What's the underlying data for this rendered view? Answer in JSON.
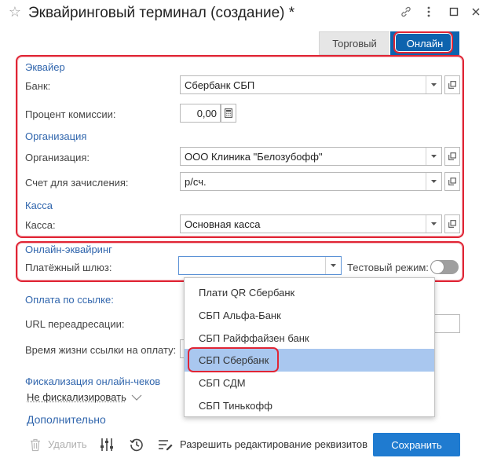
{
  "window": {
    "title": "Эквайринговый терминал (создание) *"
  },
  "tabs": [
    {
      "label": "Торговый",
      "active": false
    },
    {
      "label": "Онлайн",
      "active": true
    }
  ],
  "acquirer": {
    "heading": "Эквайер",
    "bank_label": "Банк:",
    "bank_value": "Сбербанк СБП",
    "commission_label": "Процент комиссии:",
    "commission_value": "0,00"
  },
  "organization": {
    "heading": "Организация",
    "org_label": "Организация:",
    "org_value": "ООО Клиника \"Белозубофф\"",
    "account_label": "Счет для зачисления:",
    "account_value": "р/сч."
  },
  "cash": {
    "heading": "Касса",
    "cash_label": "Касса:",
    "cash_value": "Основная касса"
  },
  "online_acquiring": {
    "heading": "Онлайн-эквайринг",
    "gateway_label": "Платёжный шлюз:",
    "gateway_value": "",
    "test_mode_label": "Тестовый режим:",
    "test_mode_on": false
  },
  "payment_link": {
    "heading": "Оплата по ссылке:",
    "redirect_label": "URL переадресации:",
    "lifetime_label": "Время жизни ссылки на оплату:"
  },
  "fiscal": {
    "heading": "Фискализация онлайн-чеков",
    "mode_value": "Не фискализировать"
  },
  "more_link": "Дополнительно",
  "gateway_dropdown": {
    "options": [
      "Плати QR Сбербанк",
      "СБП Альфа-Банк",
      "СБП Райффайзен банк",
      "СБП Сбербанк",
      "СБП СДМ",
      "СБП Тинькофф"
    ],
    "selected_index": 3
  },
  "footer": {
    "delete_label": "Удалить",
    "allow_edit_label": "Разрешить редактирование реквизитов",
    "save_label": "Сохранить"
  },
  "colors": {
    "accent_blue": "#0d63ae",
    "section_blue": "#3166ad",
    "highlight_red": "#e02535",
    "selected_row": "#a9c7ef",
    "save_button": "#1f7bd0"
  }
}
